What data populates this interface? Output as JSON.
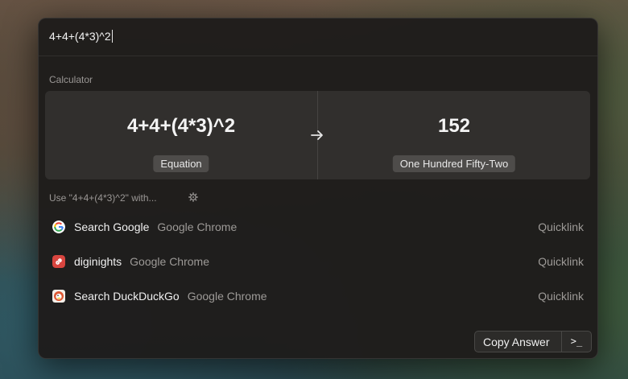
{
  "search": {
    "query": "4+4+(4*3)^2"
  },
  "calculator": {
    "section_label": "Calculator",
    "equation": "4+4+(4*3)^2",
    "equation_tag": "Equation",
    "result": "152",
    "result_tag": "One Hundred Fifty-Two"
  },
  "use_with": {
    "label": "Use \"4+4+(4*3)^2\" with...",
    "icon": "gear-icon"
  },
  "results": [
    {
      "title": "Search Google",
      "subtitle": "Google Chrome",
      "accessory": "Quicklink",
      "icon": "google-icon"
    },
    {
      "title": "diginights",
      "subtitle": "Google Chrome",
      "accessory": "Quicklink",
      "icon": "link-icon"
    },
    {
      "title": "Search DuckDuckGo",
      "subtitle": "Google Chrome",
      "accessory": "Quicklink",
      "icon": "duckduckgo-icon"
    }
  ],
  "footer": {
    "primary_action": "Copy Answer",
    "secondary_action": ">_"
  },
  "colors": {
    "window_bg": "#1e1c1b",
    "link_icon": "#e04a4a",
    "duck_icon": "#de5833"
  }
}
